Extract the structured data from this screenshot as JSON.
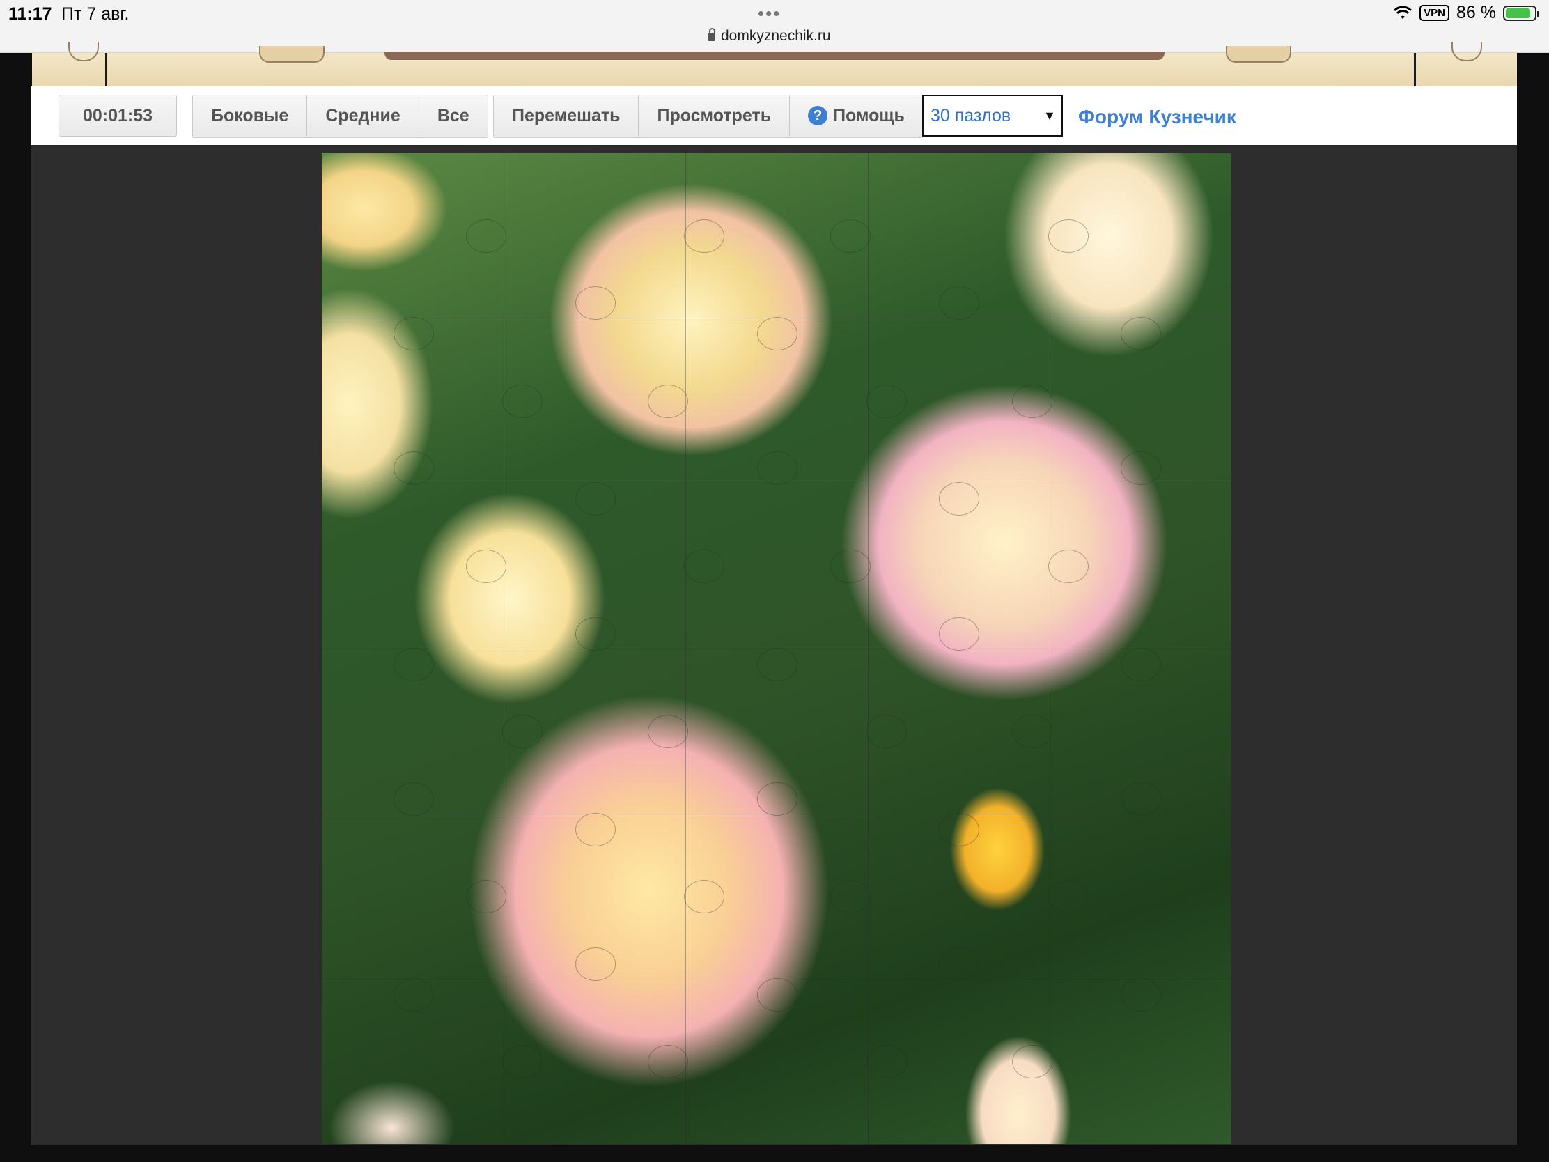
{
  "status_bar": {
    "time": "11:17",
    "date": "Пт 7 авг.",
    "dots": "•••",
    "url": "domkyznechik.ru",
    "vpn": "VPN",
    "battery": "86 %"
  },
  "toolbar": {
    "timer": "00:01:53",
    "filters": [
      "Боковые",
      "Средние",
      "Все"
    ],
    "actions": [
      "Перемешать",
      "Просмотреть",
      "Помощь"
    ],
    "help_icon": "?",
    "pieces_select": "30 пазлов",
    "forum_link": "Форум Кузнечик"
  },
  "puzzle": {
    "image_subject": "rose-bush-photo",
    "pieces_total": 30,
    "columns": 5,
    "rows": 6
  },
  "colors": {
    "link": "#3f7fd1",
    "workspace": "#2d2d2d",
    "toolbar_border": "#2a2a2a"
  }
}
